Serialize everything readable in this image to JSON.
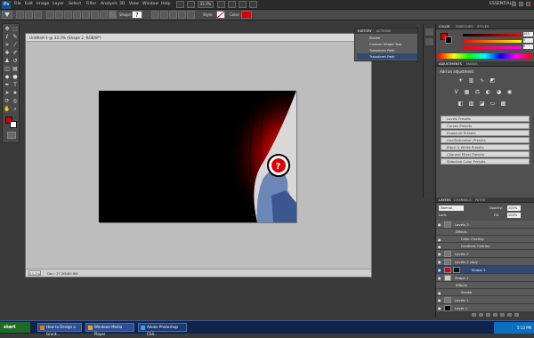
{
  "menubar": {
    "app_logo": "Ps",
    "items": [
      "File",
      "Edit",
      "Image",
      "Layer",
      "Select",
      "Filter",
      "Analysis",
      "3D",
      "View",
      "Window",
      "Help"
    ],
    "workspace": "ESSENTIALS"
  },
  "optionsbar": {
    "shape_label": "Shape:",
    "style_label": "Style:",
    "color_label": "Color:",
    "color_value": "#e00000"
  },
  "document": {
    "title": "Untitled-1 @ 33.3% (Shape 2, RGB/8*)",
    "zoom": "33.3%",
    "doc_size": "Doc: 17.2M/60.6M"
  },
  "history": {
    "tabs": [
      "HISTORY",
      "ACTIONS"
    ],
    "rows": [
      "Stroke",
      "Custom Shape Tool",
      "Transform Path",
      "Transform Path"
    ]
  },
  "color_panel": {
    "tabs": [
      "COLOR",
      "SWATCHES",
      "STYLES"
    ],
    "values": [
      "255",
      "0",
      "0"
    ]
  },
  "adjustments": {
    "tabs": [
      "ADJUSTMENTS",
      "MASKS"
    ],
    "title": "Add an adjustment",
    "presets": [
      "Levels Presets",
      "Curves Presets",
      "Exposure Presets",
      "Hue/Saturation Presets",
      "Black & White Presets",
      "Channel Mixer Presets",
      "Selective Color Presets"
    ]
  },
  "layers_panel": {
    "tabs": [
      "LAYERS",
      "CHANNELS",
      "PATHS"
    ],
    "blend_mode": "Normal",
    "opacity_label": "Opacity:",
    "opacity": "100%",
    "lock_label": "Lock:",
    "fill_label": "Fill:",
    "fill": "100%",
    "rows": [
      {
        "name": "Levels 3"
      },
      {
        "name": "Effects"
      },
      {
        "name": "Color Overlay"
      },
      {
        "name": "Gradient Overlay"
      },
      {
        "name": "Levels 2"
      },
      {
        "name": "Levels 2 copy"
      },
      {
        "name": "Shape 2"
      },
      {
        "name": "Shape 1"
      },
      {
        "name": "Effects"
      },
      {
        "name": "Stroke"
      },
      {
        "name": "Levels 1"
      },
      {
        "name": "Layer 1"
      }
    ]
  },
  "taskbar": {
    "start": "start",
    "tasks": [
      "How to Design a Grunt...",
      "Windows Media Player",
      "Adobe Photoshop CS4..."
    ],
    "clock": "5:13 PM"
  },
  "colors": {
    "accent_red": "#e00000",
    "layer_selected": "#2f4a6e",
    "taskbar_blue": "#10254e"
  }
}
